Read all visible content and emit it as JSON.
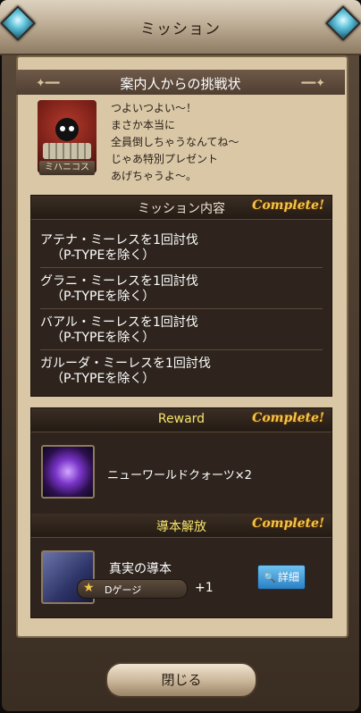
{
  "header": {
    "title": "ミッション"
  },
  "challenge": {
    "banner_title": "案内人からの挑戦状",
    "character_name": "ミハニコス",
    "lines": [
      "つよいつよい〜！",
      "まさか本当に",
      "全員倒しちゃうなんてね〜",
      "じゃあ特別プレゼント",
      "あげちゃうよ〜。"
    ]
  },
  "mission": {
    "title": "ミッション内容",
    "status": "Complete!",
    "items": [
      {
        "line1": "アテナ・ミーレスを1回討伐",
        "line2": "（P-TYPEを除く）"
      },
      {
        "line1": "グラニ・ミーレスを1回討伐",
        "line2": "（P-TYPEを除く）"
      },
      {
        "line1": "バアル・ミーレスを1回討伐",
        "line2": "（P-TYPEを除く）"
      },
      {
        "line1": "ガルーダ・ミーレスを1回討伐",
        "line2": "（P-TYPEを除く）"
      }
    ]
  },
  "reward": {
    "title": "Reward",
    "status": "Complete!",
    "item_name": "ニューワールドクォーツ×2"
  },
  "unlock": {
    "title": "導本解放",
    "status": "Complete!",
    "item_name": "真実の導本",
    "gauge_label": "Dゲージ",
    "gauge_star": "★",
    "gauge_bonus": "+1",
    "detail_button": "詳細"
  },
  "footer": {
    "close_button": "閉じる"
  },
  "colors": {
    "accent_gold": "#f3c54a",
    "reward_yellow": "#f6e56a",
    "detail_blue": "#2a7fc4"
  }
}
